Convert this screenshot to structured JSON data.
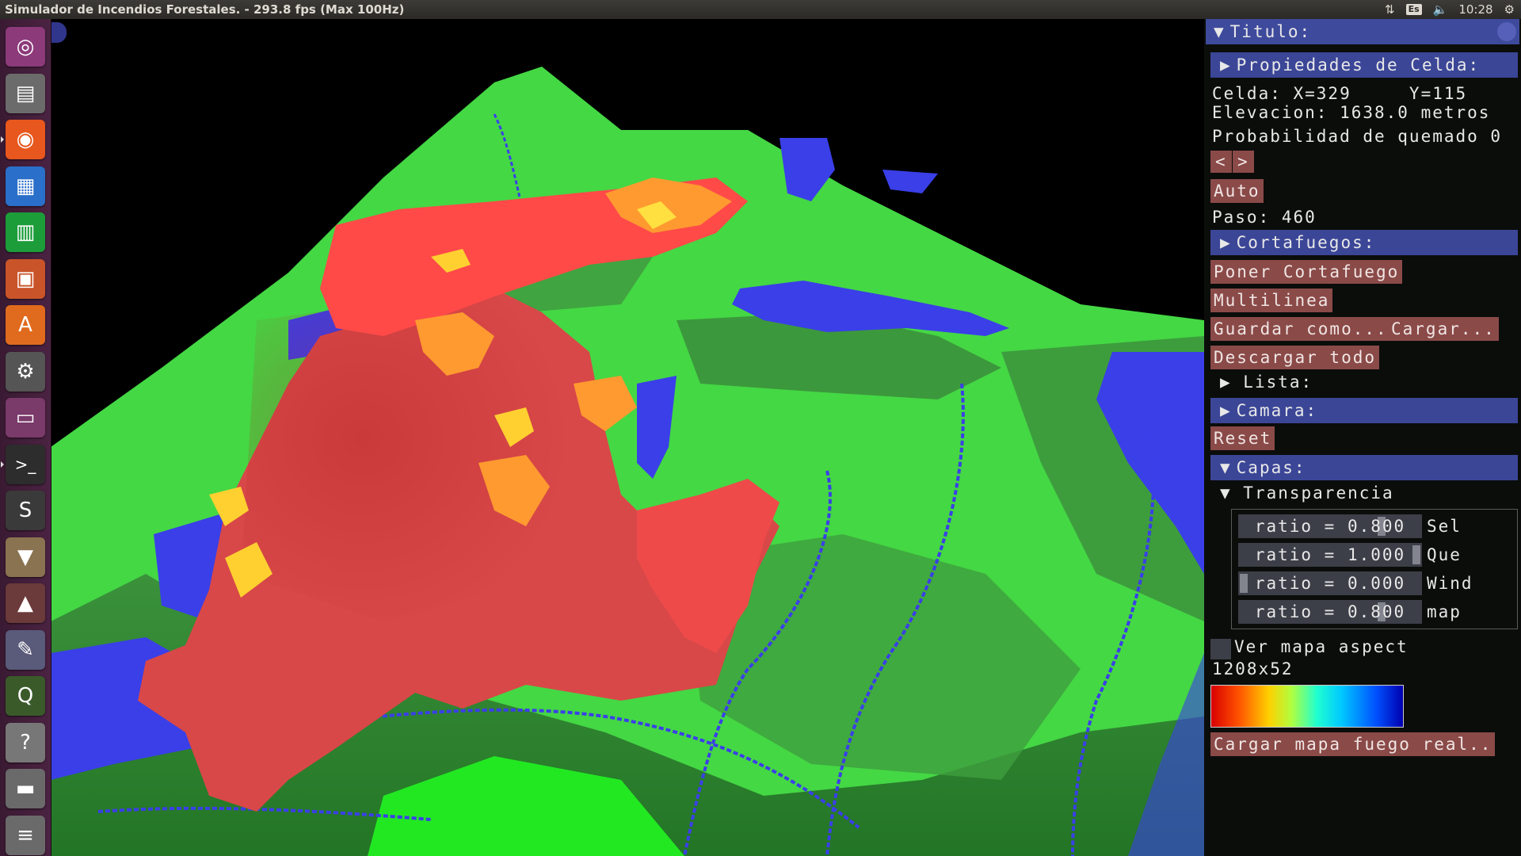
{
  "window": {
    "title": "Simulador de Incendios Forestales. - 293.8 fps (Max 100Hz)"
  },
  "tray": {
    "network_icon": "network-updown-icon",
    "keyboard_layout": "Es",
    "volume_icon": "speaker-icon",
    "clock": "10:28",
    "settings_icon": "gear-icon"
  },
  "launcher": {
    "items": [
      {
        "name": "ubuntu-dash",
        "icon": "ubuntu-logo-icon",
        "color": "#8c3a7a"
      },
      {
        "name": "files",
        "icon": "file-cabinet-icon",
        "color": "#6b6b6b"
      },
      {
        "name": "firefox",
        "icon": "firefox-icon",
        "color": "#e8571e"
      },
      {
        "name": "writer",
        "icon": "document-icon",
        "color": "#2a6fc9"
      },
      {
        "name": "calc",
        "icon": "spreadsheet-icon",
        "color": "#1d9c3a"
      },
      {
        "name": "impress",
        "icon": "presentation-icon",
        "color": "#c9542a"
      },
      {
        "name": "software-center",
        "icon": "shopping-bag-icon",
        "color": "#e06b1e"
      },
      {
        "name": "system-settings",
        "icon": "wrench-gear-icon",
        "color": "#555555"
      },
      {
        "name": "workspace-switcher",
        "icon": "workspace-icon",
        "color": "#7a3a6a"
      },
      {
        "name": "terminal",
        "icon": "terminal-icon",
        "color": "#2d2d2d"
      },
      {
        "name": "sublime-text",
        "icon": "sublime-icon",
        "color": "#3a3a3a"
      },
      {
        "name": "archive-manager",
        "icon": "archive-icon",
        "color": "#8a7350"
      },
      {
        "name": "vlc",
        "icon": "traffic-cone-icon",
        "color": "#6b3a3a"
      },
      {
        "name": "inkscape",
        "icon": "pen-tool-icon",
        "color": "#5a5a7a"
      },
      {
        "name": "qgis",
        "icon": "qgis-icon",
        "color": "#3a5a2a"
      },
      {
        "name": "help",
        "icon": "question-mark-icon",
        "color": "#777777"
      },
      {
        "name": "usb-drive",
        "icon": "drive-icon",
        "color": "#6a6a6a"
      },
      {
        "name": "trash",
        "icon": "stack-icon",
        "color": "#6a6a6a"
      }
    ]
  },
  "panel": {
    "title": "Titulo:",
    "cell_header": "Propiedades de Celda:",
    "cell_coords": "Celda: X=329     Y=115",
    "elevation": "Elevacion: 1638.0 metros",
    "burn_prob": "Probabilidad de quemado 0",
    "prev_label": "<",
    "next_label": ">",
    "auto_label": "Auto",
    "step": "Paso: 460",
    "firebreak_header": "Cortafuegos:",
    "put_firebreak": "Poner Cortafuego",
    "multiline": "Multilinea",
    "save_as": "Guardar como...",
    "load": "Cargar...",
    "unload_all": "Descargar todo",
    "list": "Lista:",
    "camera_header": "Camara:",
    "reset": "Reset",
    "layers_header": "Capas:",
    "transparency": "Transparencia",
    "sliders": [
      {
        "text": "ratio = 0.800",
        "label": "Sel",
        "value": 0.8
      },
      {
        "text": "ratio = 1.000",
        "label": "Que",
        "value": 1.0
      },
      {
        "text": "ratio = 0.000",
        "label": "Wind",
        "value": 0.0
      },
      {
        "text": "ratio = 0.800",
        "label": "map",
        "value": 0.8
      }
    ],
    "aspect_checkbox": "Ver mapa aspect",
    "image_size": "1208x52",
    "load_real_fire": "Cargar mapa fuego real.."
  },
  "colors": {
    "panel_header": "#3b4697",
    "button": "#8a4a48",
    "terrain_green": "#3fdc3f",
    "water_blue": "#3843e6",
    "fire_red": "#d84848"
  }
}
